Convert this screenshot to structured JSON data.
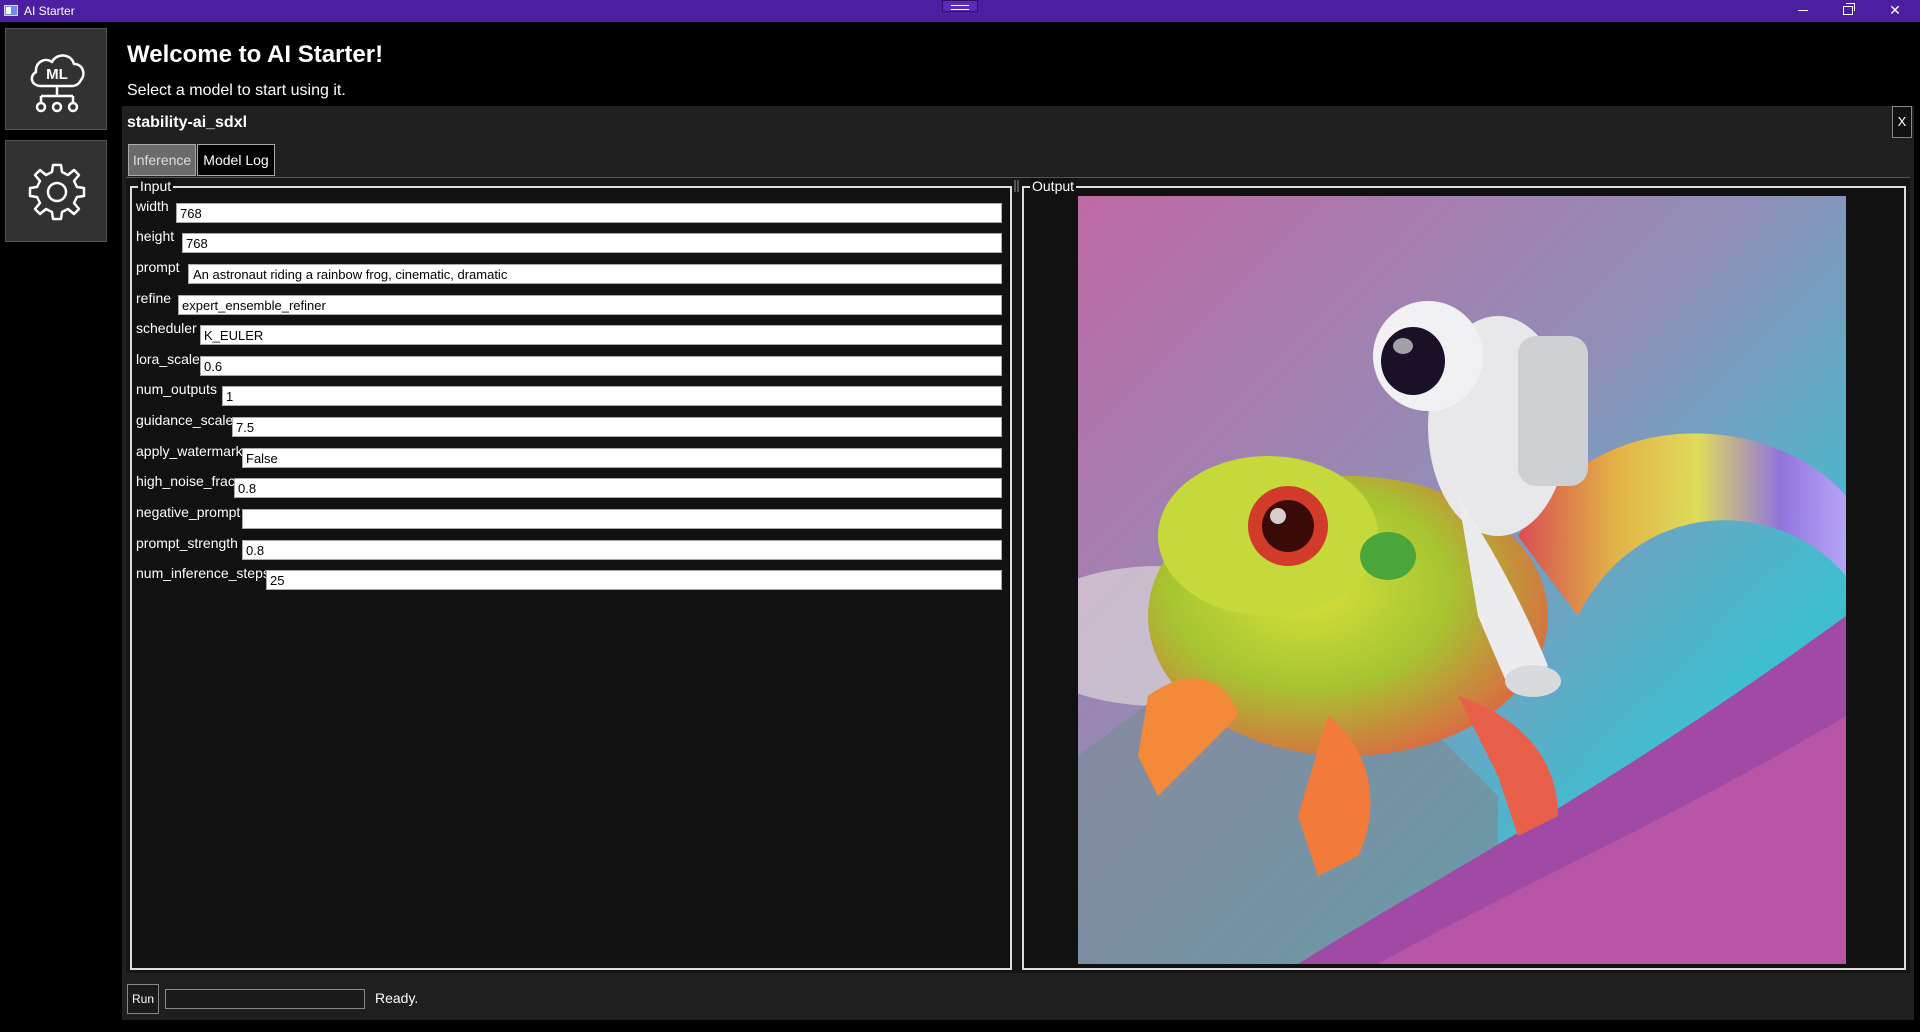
{
  "window": {
    "title": "AI Starter",
    "controls": {
      "minimize": "minimize-icon",
      "maximize": "restore-icon",
      "close": "✕"
    }
  },
  "nav": {
    "items": [
      {
        "name": "ml-models",
        "icon": "ml-cloud-network-icon",
        "label": "ML"
      },
      {
        "name": "settings",
        "icon": "gear-icon"
      }
    ]
  },
  "header": {
    "title": "Welcome to AI Starter!",
    "subtitle": "Select a model to start using it."
  },
  "model": {
    "name": "stability-ai_sdxl",
    "close_label": "X",
    "tabs": [
      {
        "label": "Inference",
        "selected": true
      },
      {
        "label": "Model Log",
        "selected": false
      }
    ],
    "input_title": "Input",
    "output_title": "Output",
    "inputs": [
      {
        "label": "width",
        "value": "768"
      },
      {
        "label": "height",
        "value": "768"
      },
      {
        "label": "prompt",
        "value": "An astronaut riding a rainbow frog, cinematic, dramatic"
      },
      {
        "label": "refine",
        "value": "expert_ensemble_refiner"
      },
      {
        "label": "scheduler",
        "value": "K_EULER"
      },
      {
        "label": "lora_scale",
        "value": "0.6"
      },
      {
        "label": "num_outputs",
        "value": "1"
      },
      {
        "label": "guidance_scale",
        "value": "7.5"
      },
      {
        "label": "apply_watermark",
        "value": "False"
      },
      {
        "label": "high_noise_frac",
        "value": "0.8"
      },
      {
        "label": "negative_prompt",
        "value": ""
      },
      {
        "label": "prompt_strength",
        "value": "0.8"
      },
      {
        "label": "num_inference_steps",
        "value": "25"
      }
    ],
    "run_label": "Run",
    "progress": 0,
    "status": "Ready."
  },
  "colors": {
    "titlebar": "#4b1fa0",
    "panel": "#1f1f1f",
    "background": "#000000"
  }
}
